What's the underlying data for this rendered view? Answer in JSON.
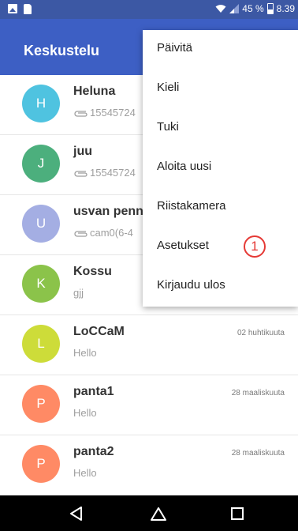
{
  "status_bar": {
    "battery_percent": "45 %",
    "time": "8.39"
  },
  "app_bar": {
    "title": "Keskustelu"
  },
  "conversations": [
    {
      "initial": "H",
      "name": "Heluna",
      "preview": "15545724",
      "has_attachment": true,
      "date": "",
      "color": "#4fc3e0"
    },
    {
      "initial": "J",
      "name": "juu",
      "preview": "15545724",
      "has_attachment": true,
      "date": "",
      "color": "#4caf7d"
    },
    {
      "initial": "U",
      "name": "usvan penn",
      "preview": "cam0(6-4",
      "has_attachment": true,
      "date": "",
      "color": "#a4aee3"
    },
    {
      "initial": "K",
      "name": "Kossu",
      "preview": "gjj",
      "has_attachment": false,
      "date": "",
      "color": "#8bc34a"
    },
    {
      "initial": "L",
      "name": "LoCCaM",
      "preview": "Hello",
      "has_attachment": false,
      "date": "02 huhtikuuta",
      "color": "#cddc39"
    },
    {
      "initial": "P",
      "name": "panta1",
      "preview": "Hello",
      "has_attachment": false,
      "date": "28 maaliskuuta",
      "color": "#ff8a65"
    },
    {
      "initial": "P",
      "name": "panta2",
      "preview": "Hello",
      "has_attachment": false,
      "date": "28 maaliskuuta",
      "color": "#ff8a65"
    }
  ],
  "menu": {
    "items": [
      "Päivitä",
      "Kieli",
      "Tuki",
      "Aloita uusi",
      "Riistakamera",
      "Asetukset",
      "Kirjaudu ulos"
    ]
  },
  "callout": {
    "label": "1",
    "color": "#e53935"
  },
  "icons": {
    "status": [
      "image-icon",
      "sim-icon",
      "wifi-icon",
      "signal-icon",
      "battery-icon"
    ],
    "nav": [
      "back-icon",
      "home-icon",
      "recents-icon"
    ],
    "attachment": "paperclip-icon"
  }
}
